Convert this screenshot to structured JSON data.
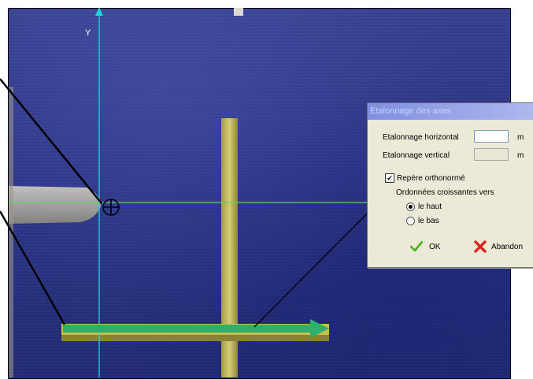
{
  "video": {
    "axis_label_y": "Y"
  },
  "dialog": {
    "title": "Etalonnage des axes",
    "horizontal_label": "Etalonnage horizontal",
    "horizontal_value": "",
    "vertical_label": "Etalonnage vertical",
    "vertical_value": "",
    "unit_h": "m",
    "unit_v": "m",
    "orthonormal_label": "Repère orthonormé",
    "orthonormal_checked": true,
    "ordinate_label": "Ordonnées croissantes vers",
    "options": [
      "le haut",
      "le bas"
    ],
    "selected_option": "le haut",
    "ok_label": "OK",
    "cancel_label": "Abandon"
  },
  "colors": {
    "axis": "#1fd3dc",
    "green_arrow": "#2fae6e",
    "horizontal_line": "#5bd46a"
  },
  "icons": [
    "crosshair-icon",
    "check-icon",
    "cross-icon"
  ]
}
